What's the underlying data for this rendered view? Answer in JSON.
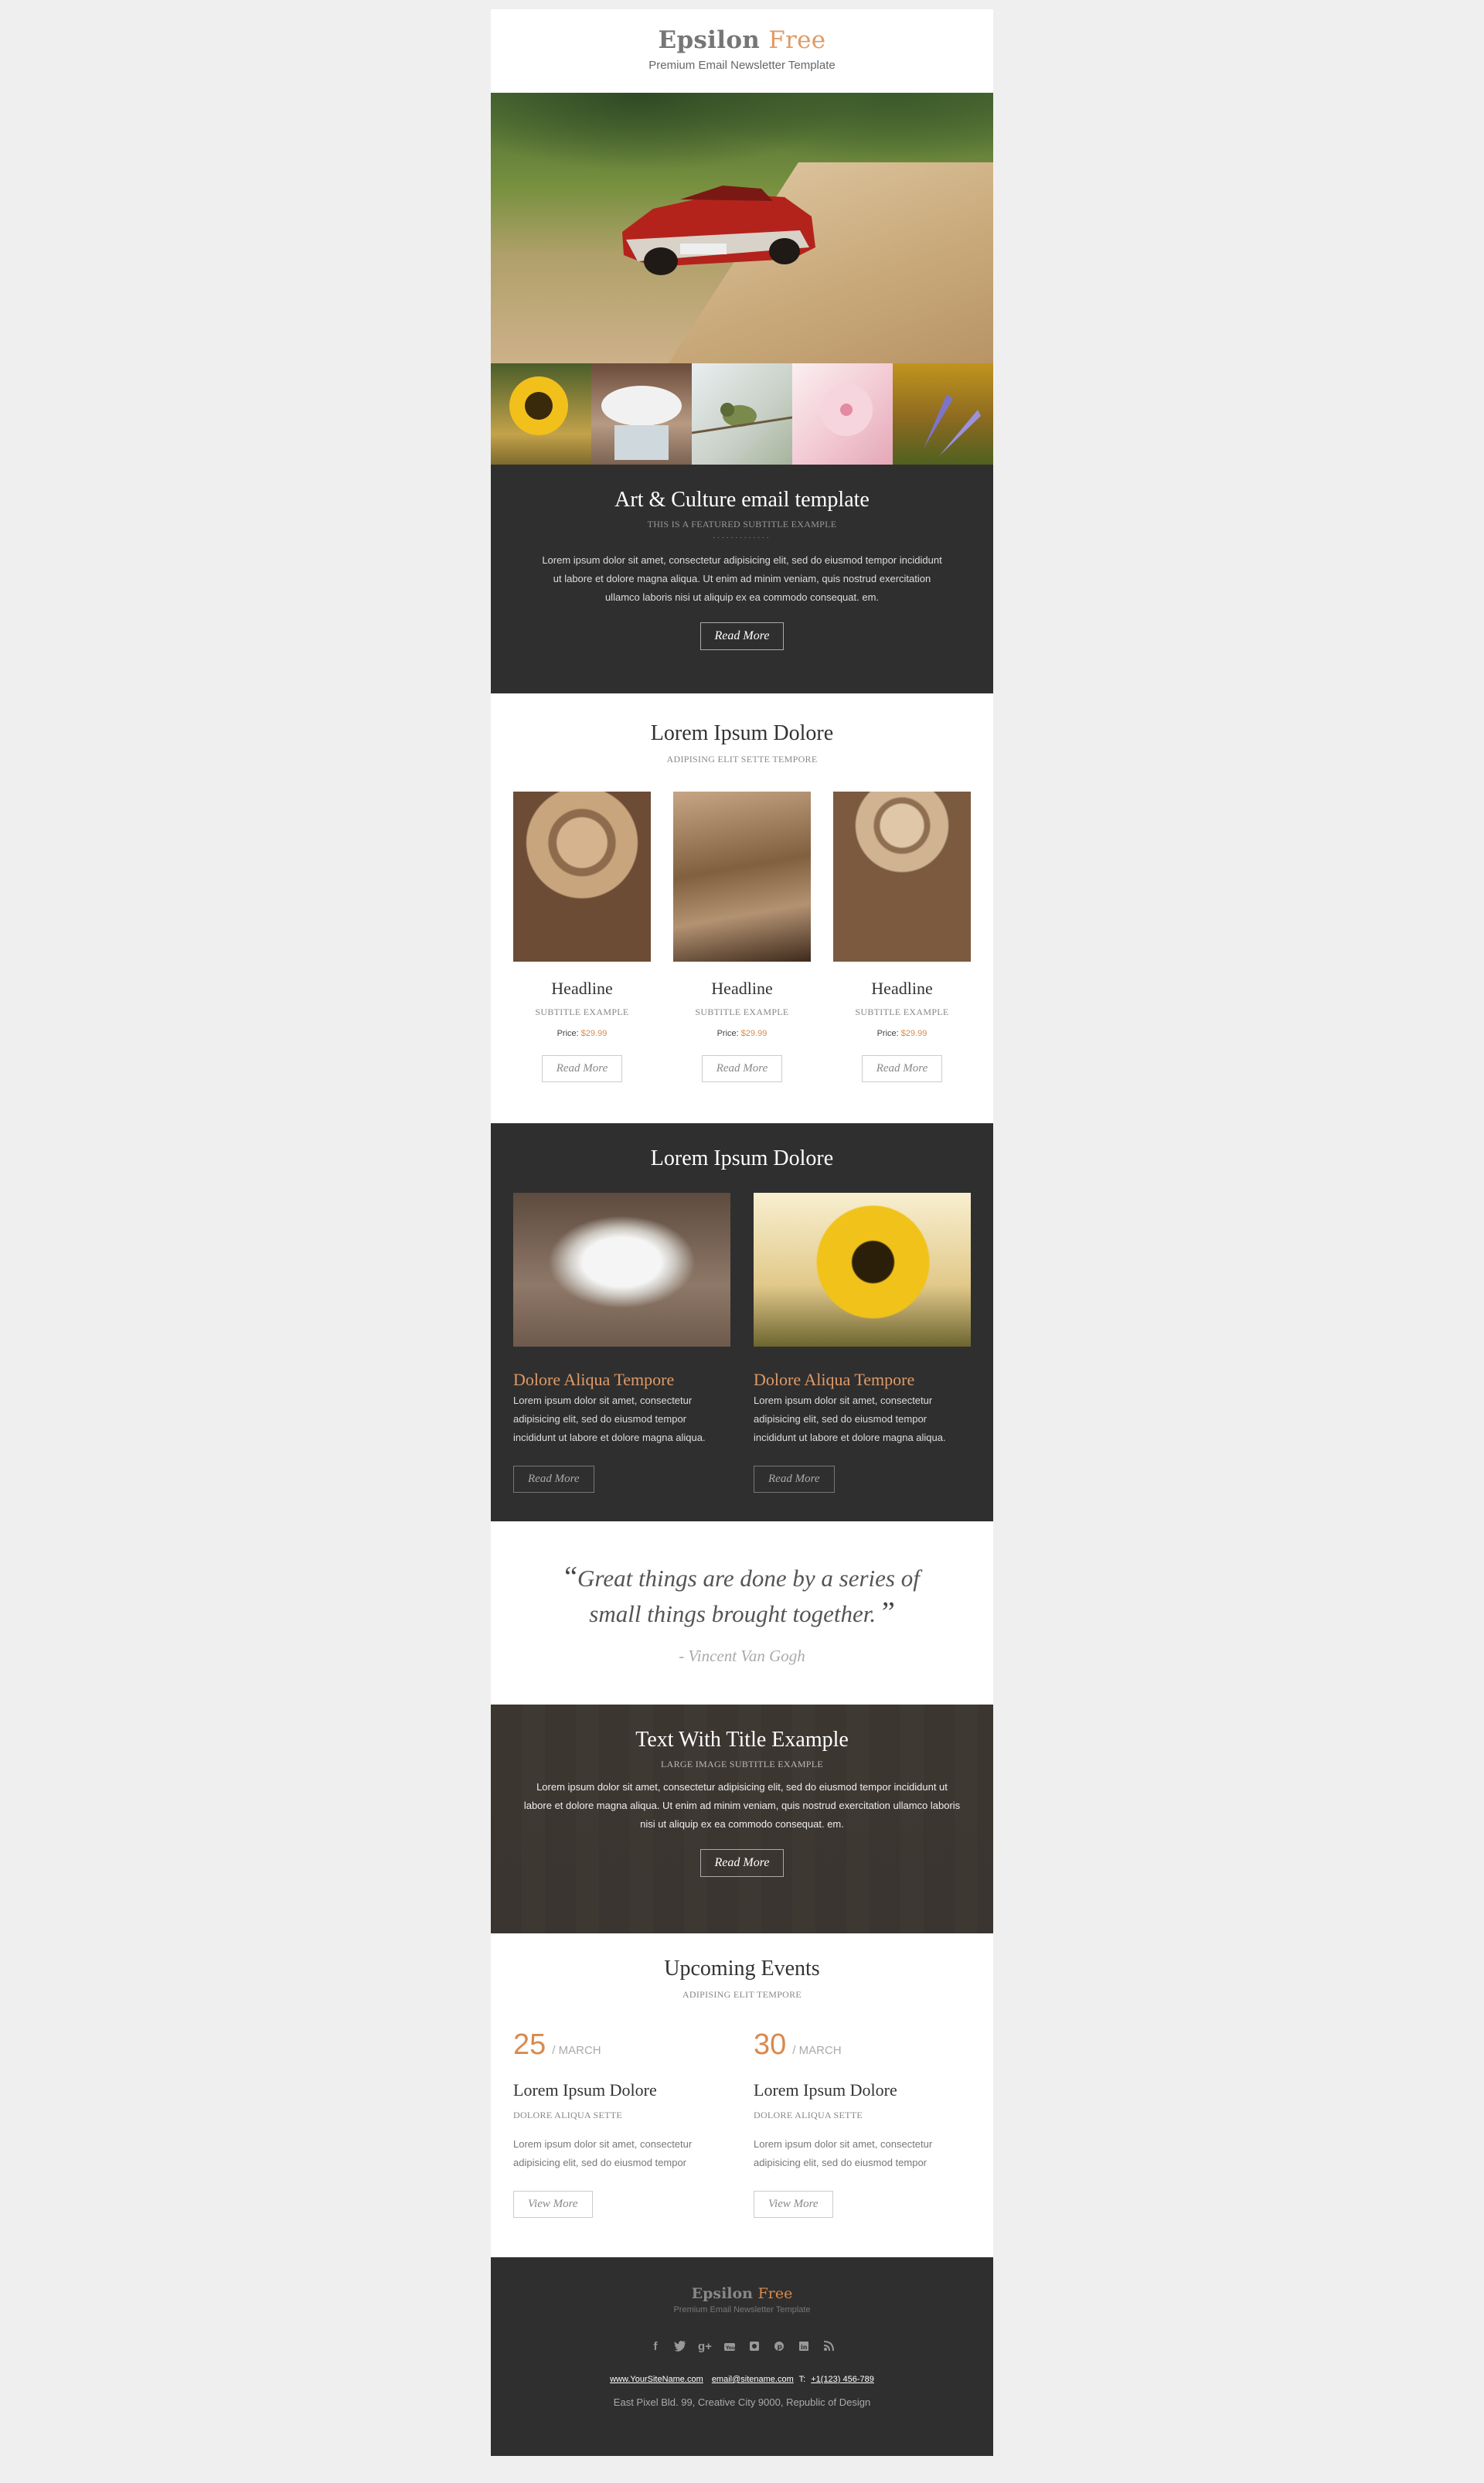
{
  "header": {
    "logo_main": "Epsilon",
    "logo_accent": "Free",
    "tagline": "Premium Email Newsletter Template"
  },
  "feature": {
    "title": "Art & Culture email template",
    "subtitle": "THIS IS A FEATURED SUBTITLE EXAMPLE",
    "dots": ".............",
    "text": "Lorem ipsum dolor sit amet, consectetur adipisicing elit, sed do eiusmod tempor incididunt ut labore et dolore magna aliqua. Ut enim ad minim veniam, quis nostrud exercitation ullamco laboris nisi ut aliquip ex ea commodo consequat. em.",
    "button": "Read More"
  },
  "three_col": {
    "title": "Lorem Ipsum Dolore",
    "subtitle": "ADIPISING ELIT SETTE TEMPORE",
    "items": [
      {
        "title": "Headline",
        "subtitle": "SUBTITLE EXAMPLE",
        "price_label": "Price:",
        "price": "$29.99",
        "button": "Read More"
      },
      {
        "title": "Headline",
        "subtitle": "SUBTITLE EXAMPLE",
        "price_label": "Price:",
        "price": "$29.99",
        "button": "Read More"
      },
      {
        "title": "Headline",
        "subtitle": "SUBTITLE EXAMPLE",
        "price_label": "Price:",
        "price": "$29.99",
        "button": "Read More"
      }
    ]
  },
  "two_col": {
    "title": "Lorem Ipsum Dolore",
    "items": [
      {
        "title": "Dolore Aliqua Tempore",
        "text": "Lorem ipsum dolor sit amet, consectetur adipisicing elit, sed do eiusmod tempor incididunt ut labore et dolore magna aliqua.",
        "button": "Read More"
      },
      {
        "title": "Dolore Aliqua Tempore",
        "text": "Lorem ipsum dolor sit amet, consectetur adipisicing elit, sed do eiusmod tempor incididunt ut labore et dolore magna aliqua.",
        "button": "Read More"
      }
    ]
  },
  "quote": {
    "open": "“",
    "text": "Great things are done by a series of small things brought together.",
    "close": "”",
    "author": "- Vincent Van Gogh"
  },
  "image_text": {
    "title": "Text With Title Example",
    "subtitle": "LARGE IMAGE SUBTITLE EXAMPLE",
    "text": "Lorem ipsum dolor sit amet, consectetur adipisicing elit, sed do eiusmod tempor incididunt ut labore et dolore magna aliqua. Ut enim ad minim veniam, quis nostrud exercitation ullamco laboris nisi ut aliquip ex ea commodo consequat. em.",
    "button": "Read More"
  },
  "events": {
    "title": "Upcoming Events",
    "subtitle": "ADIPISING ELIT TEMPORE",
    "items": [
      {
        "day": "25",
        "month": "/ MARCH",
        "title": "Lorem Ipsum Dolore",
        "subtitle": "DOLORE ALIQUA SETTE",
        "text": "Lorem ipsum dolor sit amet, consectetur adipisicing elit, sed do eiusmod tempor",
        "button": "View More"
      },
      {
        "day": "30",
        "month": "/ MARCH",
        "title": "Lorem Ipsum Dolore",
        "subtitle": "DOLORE ALIQUA SETTE",
        "text": "Lorem ipsum dolor sit amet, consectetur adipisicing elit, sed do eiusmod tempor",
        "button": "View More"
      }
    ]
  },
  "footer": {
    "logo_main": "Epsilon",
    "logo_accent": "Free",
    "tagline": "Premium Email Newsletter Template",
    "social_icons": [
      "facebook-icon",
      "twitter-icon",
      "google-plus-icon",
      "youtube-icon",
      "instagram-icon",
      "pinterest-icon",
      "linkedin-icon",
      "rss-icon"
    ],
    "website": "www.YourSiteName.com",
    "email": "email@sitename.com",
    "phone_label": "T:",
    "phone": "+1(123) 456-789",
    "address": "East Pixel Bld. 99, Creative City 9000, Republic of Design"
  },
  "colors": {
    "accent": "#e09a66",
    "dark_bg": "#2f2f2f",
    "page_bg": "#efefef"
  }
}
